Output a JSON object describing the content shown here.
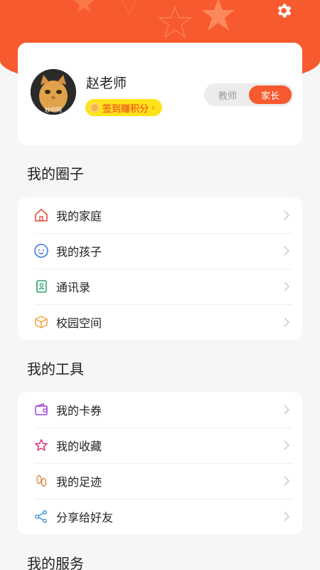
{
  "user": {
    "name": "赵老师",
    "checkin_label": "签到赚积分",
    "avatar_watermark": "妙句网"
  },
  "roles": {
    "teacher": "教师",
    "parent": "家长",
    "active": "parent"
  },
  "sections": {
    "circle": {
      "title": "我的圈子",
      "items": [
        {
          "label": "我的家庭",
          "icon": "home-icon"
        },
        {
          "label": "我的孩子",
          "icon": "child-face-icon"
        },
        {
          "label": "通讯录",
          "icon": "contacts-icon"
        },
        {
          "label": "校园空间",
          "icon": "cube-icon"
        }
      ]
    },
    "tools": {
      "title": "我的工具",
      "items": [
        {
          "label": "我的卡券",
          "icon": "wallet-icon"
        },
        {
          "label": "我的收藏",
          "icon": "star-icon"
        },
        {
          "label": "我的足迹",
          "icon": "footprint-icon"
        },
        {
          "label": "分享给好友",
          "icon": "share-icon"
        }
      ]
    },
    "services": {
      "title": "我的服务"
    }
  },
  "colors": {
    "brand": "#f65a2e",
    "checkin_bg": "#ffe31a",
    "checkin_text": "#f0701f"
  }
}
